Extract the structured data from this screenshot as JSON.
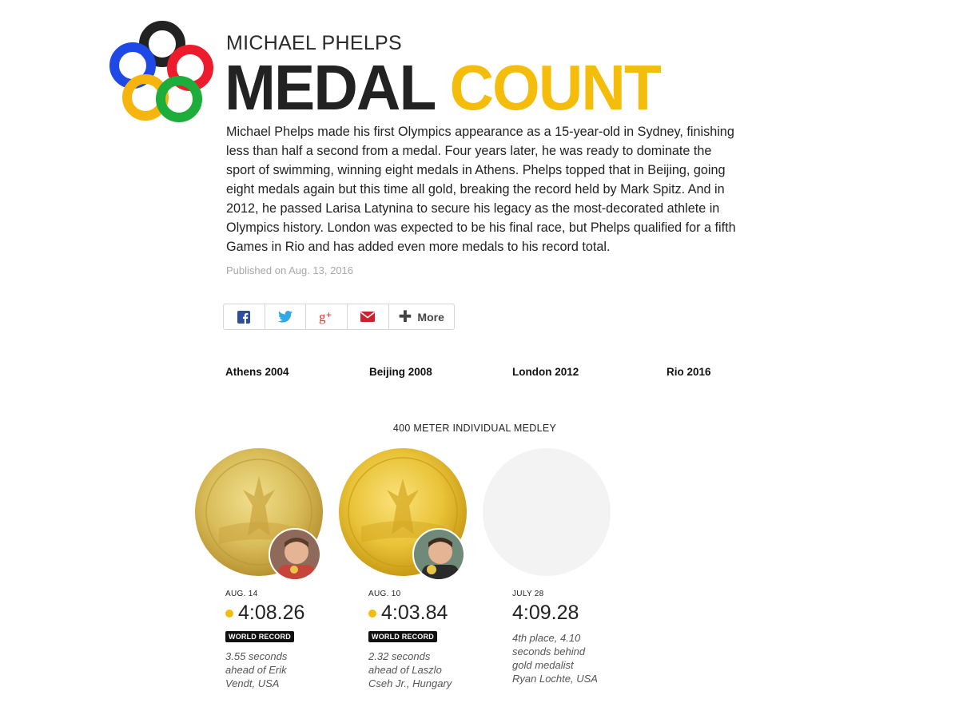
{
  "header": {
    "kicker": "MICHAEL PHELPS",
    "title_part1": "MEDAL",
    "title_part2": "COUNT"
  },
  "intro": "Michael Phelps made his first Olympics appearance as a 15-year-old in Sydney, finishing less than half a second from a medal. Four years later, he was ready to dominate the sport of swimming, winning eight medals in Athens. Phelps topped that in Beijing, going eight medals again but this time all gold, breaking the record held by Mark Spitz. And in 2012, he passed Larisa Latynina to secure his legacy as the most-decorated athlete in Olympics history. London was expected to be his final race, but Phelps qualified for a fifth Games in Rio and has added even more medals to his record total.",
  "published": "Published on Aug. 13, 2016",
  "share": {
    "more_label": "More",
    "icons": [
      "facebook-icon",
      "twitter-icon",
      "google-plus-icon",
      "email-icon",
      "plus-icon"
    ]
  },
  "games": [
    "Athens 2004",
    "Beijing 2008",
    "London 2012",
    "Rio 2016"
  ],
  "event": {
    "title": "400 METER INDIVIDUAL MEDLEY",
    "results": [
      {
        "date": "AUG. 14",
        "time": "4:08.26",
        "medal": "gold",
        "badge": "WORLD RECORD",
        "note": "3.55 seconds ahead of Erik Vendt, USA"
      },
      {
        "date": "AUG. 10",
        "time": "4:03.84",
        "medal": "gold",
        "badge": "WORLD RECORD",
        "note": "2.32 seconds ahead of Laszlo Cseh Jr., Hungary"
      },
      {
        "date": "JULY 28",
        "time": "4:09.28",
        "medal": "none",
        "badge": "",
        "note": "4th place, 4.10 seconds behind gold medalist Ryan Lochte, USA"
      }
    ]
  },
  "colors": {
    "gold_accent": "#f5bd0b",
    "ring_blue": "#1f49e6",
    "ring_black": "#222222",
    "ring_red": "#ec1c2c",
    "ring_yellow": "#f5b50e",
    "ring_green": "#1cad3a"
  }
}
